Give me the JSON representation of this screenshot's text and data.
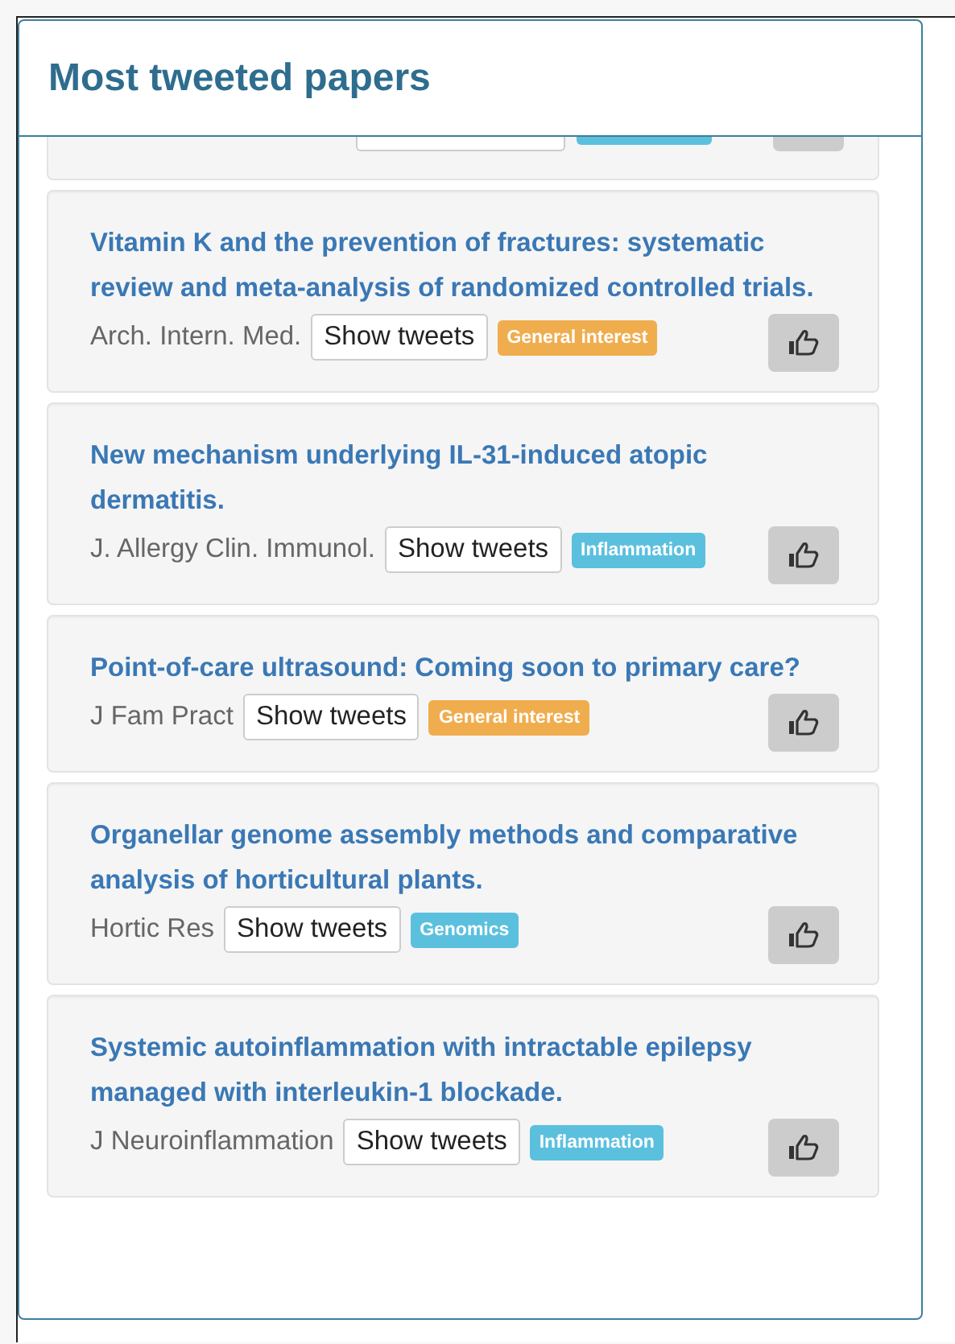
{
  "panel": {
    "title": "Most tweeted papers"
  },
  "papers": [
    {
      "title": "Vitamin K and the prevention of fractures: systematic review and meta-analysis of randomized controlled trials.",
      "journal": "Arch. Intern. Med.",
      "button": "Show tweets",
      "tag": "General interest",
      "color": "#f0ad4e"
    },
    {
      "title": "New mechanism underlying IL-31-induced atopic dermatitis.",
      "journal": "J. Allergy Clin. Immunol.",
      "button": "Show tweets",
      "tag": "Inflammation",
      "color": "#5bc0de"
    },
    {
      "title": "Point-of-care ultrasound: Coming soon to primary care?",
      "journal": "J Fam Pract",
      "button": "Show tweets",
      "tag": "General interest",
      "color": "#f0ad4e"
    },
    {
      "title": "Organellar genome assembly methods and comparative analysis of horticultural plants.",
      "journal": "Hortic Res",
      "button": "Show tweets",
      "tag": "Genomics",
      "color": "#5bc0de"
    },
    {
      "title": "Systemic autoinflammation with intractable epilepsy managed with interleukin-1 blockade.",
      "journal": "J Neuroinflammation",
      "button": "Show tweets",
      "tag": "Inflammation",
      "color": "#5bc0de"
    }
  ]
}
